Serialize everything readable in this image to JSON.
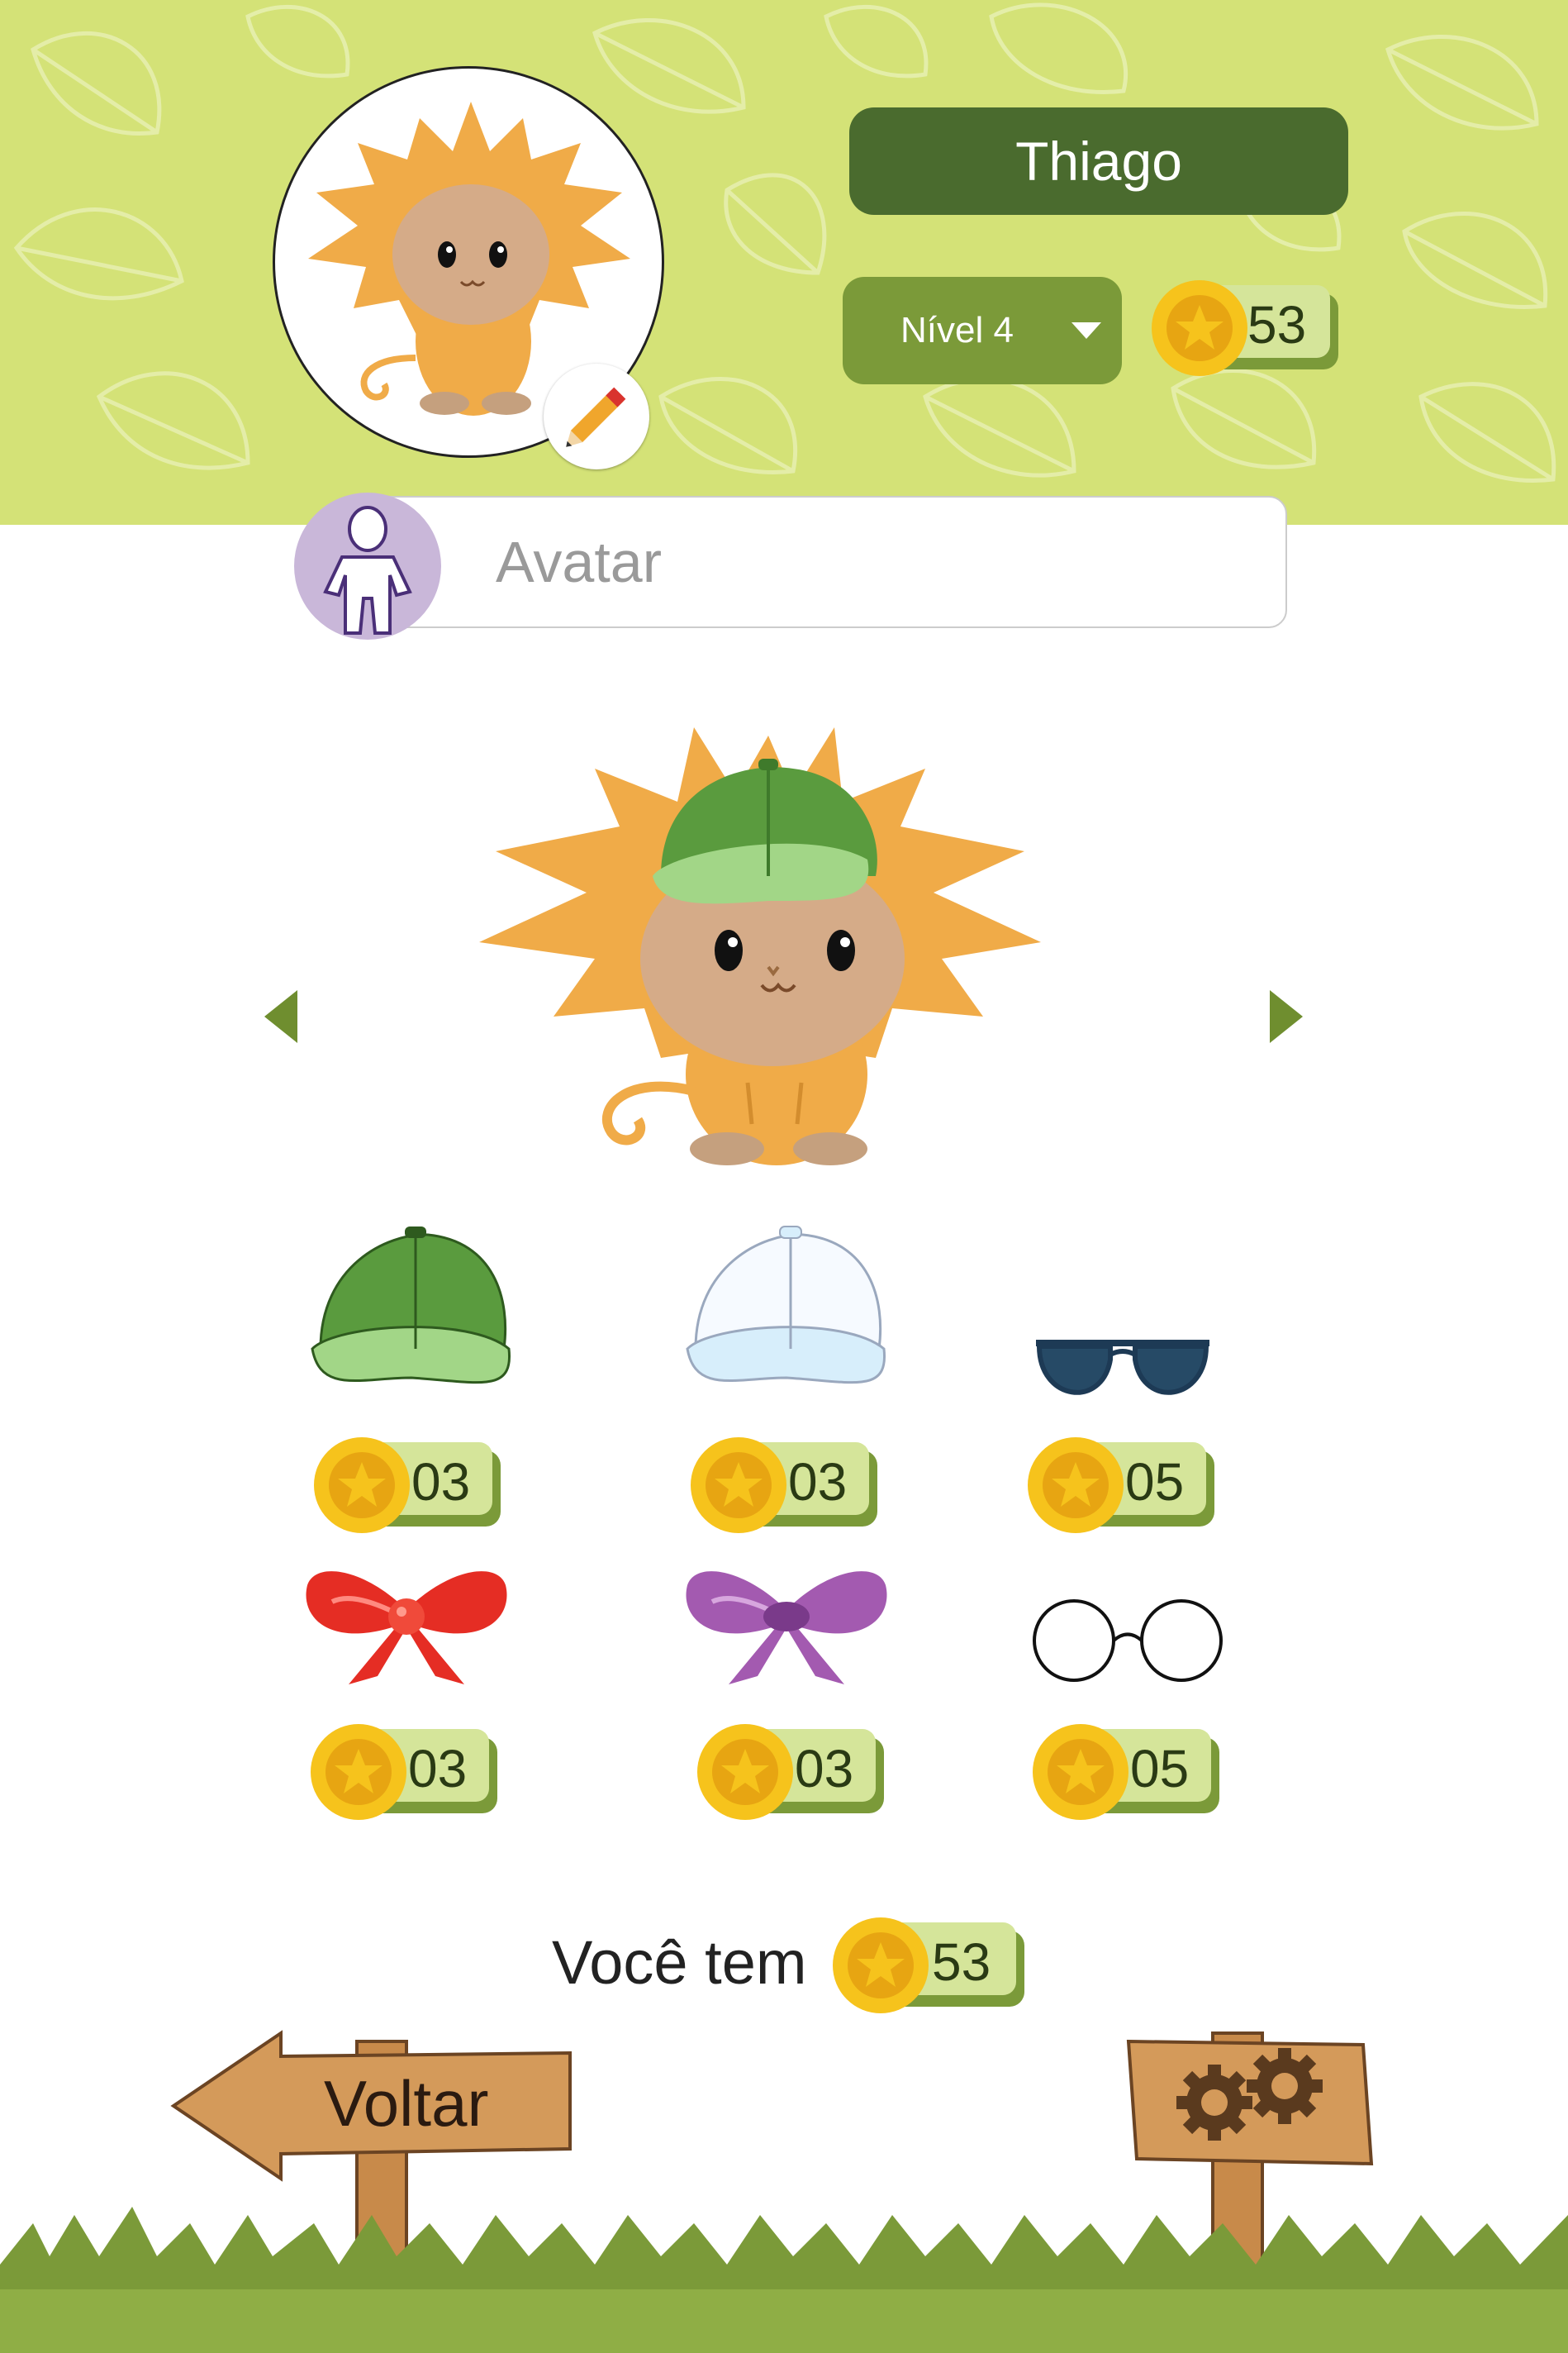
{
  "profile": {
    "name": "Thiago",
    "level_label": "Nível 4",
    "coins": "53"
  },
  "search": {
    "placeholder": "Avatar"
  },
  "shop_items": [
    {
      "name": "green-cap",
      "price": "03"
    },
    {
      "name": "white-cap",
      "price": "03"
    },
    {
      "name": "sunglasses",
      "price": "05"
    },
    {
      "name": "red-bow",
      "price": "03"
    },
    {
      "name": "purple-bow",
      "price": "03"
    },
    {
      "name": "round-glasses",
      "price": "05"
    }
  ],
  "footer": {
    "you_have_label": "Você tem",
    "coins": "53",
    "back_label": "Voltar"
  },
  "colors": {
    "header_bg": "#d4e277",
    "dark_green": "#4a6b2e",
    "olive": "#7b9a39",
    "coin_gold": "#f6c31c",
    "grass": "#7b9a39",
    "wood": "#d49a5a"
  },
  "icons": [
    "pencil-icon",
    "user-silhouette-icon",
    "star-coin-icon",
    "gear-icon",
    "arrow-left",
    "arrow-right"
  ]
}
